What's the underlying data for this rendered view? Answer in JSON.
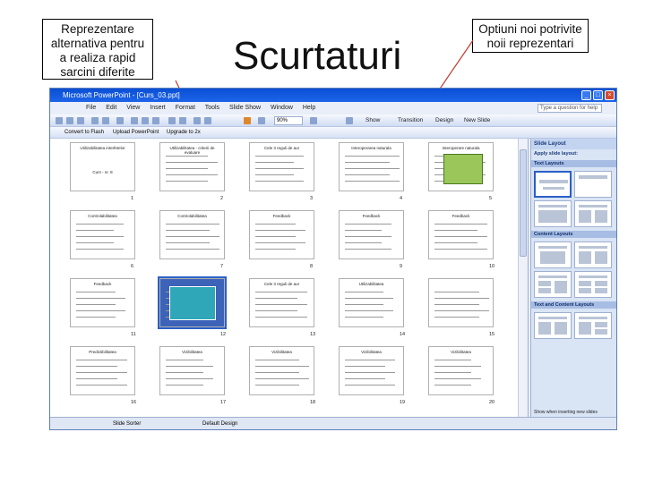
{
  "callouts": {
    "left": "Reprezentare alternativa pentru a realiza rapid sarcini diferite",
    "right": "Optiuni noi potrivite noii reprezentari"
  },
  "headline": "Scurtaturi",
  "window": {
    "title": "Microsoft PowerPoint - [Curs_03.ppt]",
    "menu": [
      "File",
      "Edit",
      "View",
      "Insert",
      "Format",
      "Tools",
      "Slide Show",
      "Window",
      "Help"
    ],
    "help_placeholder": "Type a question for help",
    "zoom": "90%",
    "toolbar_items": [
      "Show",
      "Transition",
      "Design",
      "New Slide"
    ],
    "toolbar2_items": [
      "Convert to Flash",
      "Upload PowerPoint",
      "Upgrade to 2x"
    ],
    "status": {
      "view": "Slide Sorter",
      "design": "Default Design"
    }
  },
  "slides": [
    {
      "num": "1",
      "title": "Utilizabilitatea interfetelor",
      "sub": "Curs - nr. 8"
    },
    {
      "num": "2",
      "title": "Utilizabilitatea - criterii de evaluare"
    },
    {
      "num": "3",
      "title": "Cele 3 reguli de aur"
    },
    {
      "num": "4",
      "title": "Interoperarea naturala"
    },
    {
      "num": "5",
      "title": "Interoperare naturala"
    },
    {
      "num": "6",
      "title": "Controlabilitatea"
    },
    {
      "num": "7",
      "title": "Controlabilitatea"
    },
    {
      "num": "8",
      "title": "Feedback"
    },
    {
      "num": "9",
      "title": "Feedback"
    },
    {
      "num": "10",
      "title": "Feedback"
    },
    {
      "num": "11",
      "title": "Feedback"
    },
    {
      "num": "12",
      "title": ""
    },
    {
      "num": "13",
      "title": "Cele 3 reguli de aur"
    },
    {
      "num": "14",
      "title": "Utilizabilitatea"
    },
    {
      "num": "15",
      "title": ""
    },
    {
      "num": "16",
      "title": "Predictibilitatea"
    },
    {
      "num": "17",
      "title": "Vizibilitatea"
    },
    {
      "num": "18",
      "title": "Vizibilitatea"
    },
    {
      "num": "19",
      "title": "Vizibilitatea"
    },
    {
      "num": "20",
      "title": "Vizibilitatea"
    }
  ],
  "pane": {
    "title": "Slide Layout",
    "apply": "Apply slide layout:",
    "sections": [
      "Text Layouts",
      "Content Layouts",
      "Text and Content Layouts"
    ],
    "footer": "Show when inserting new slides"
  },
  "colors": {
    "accent": "#2b5fc6",
    "titlebar": "#0a4fd4",
    "callout_line": "#c0392b"
  }
}
